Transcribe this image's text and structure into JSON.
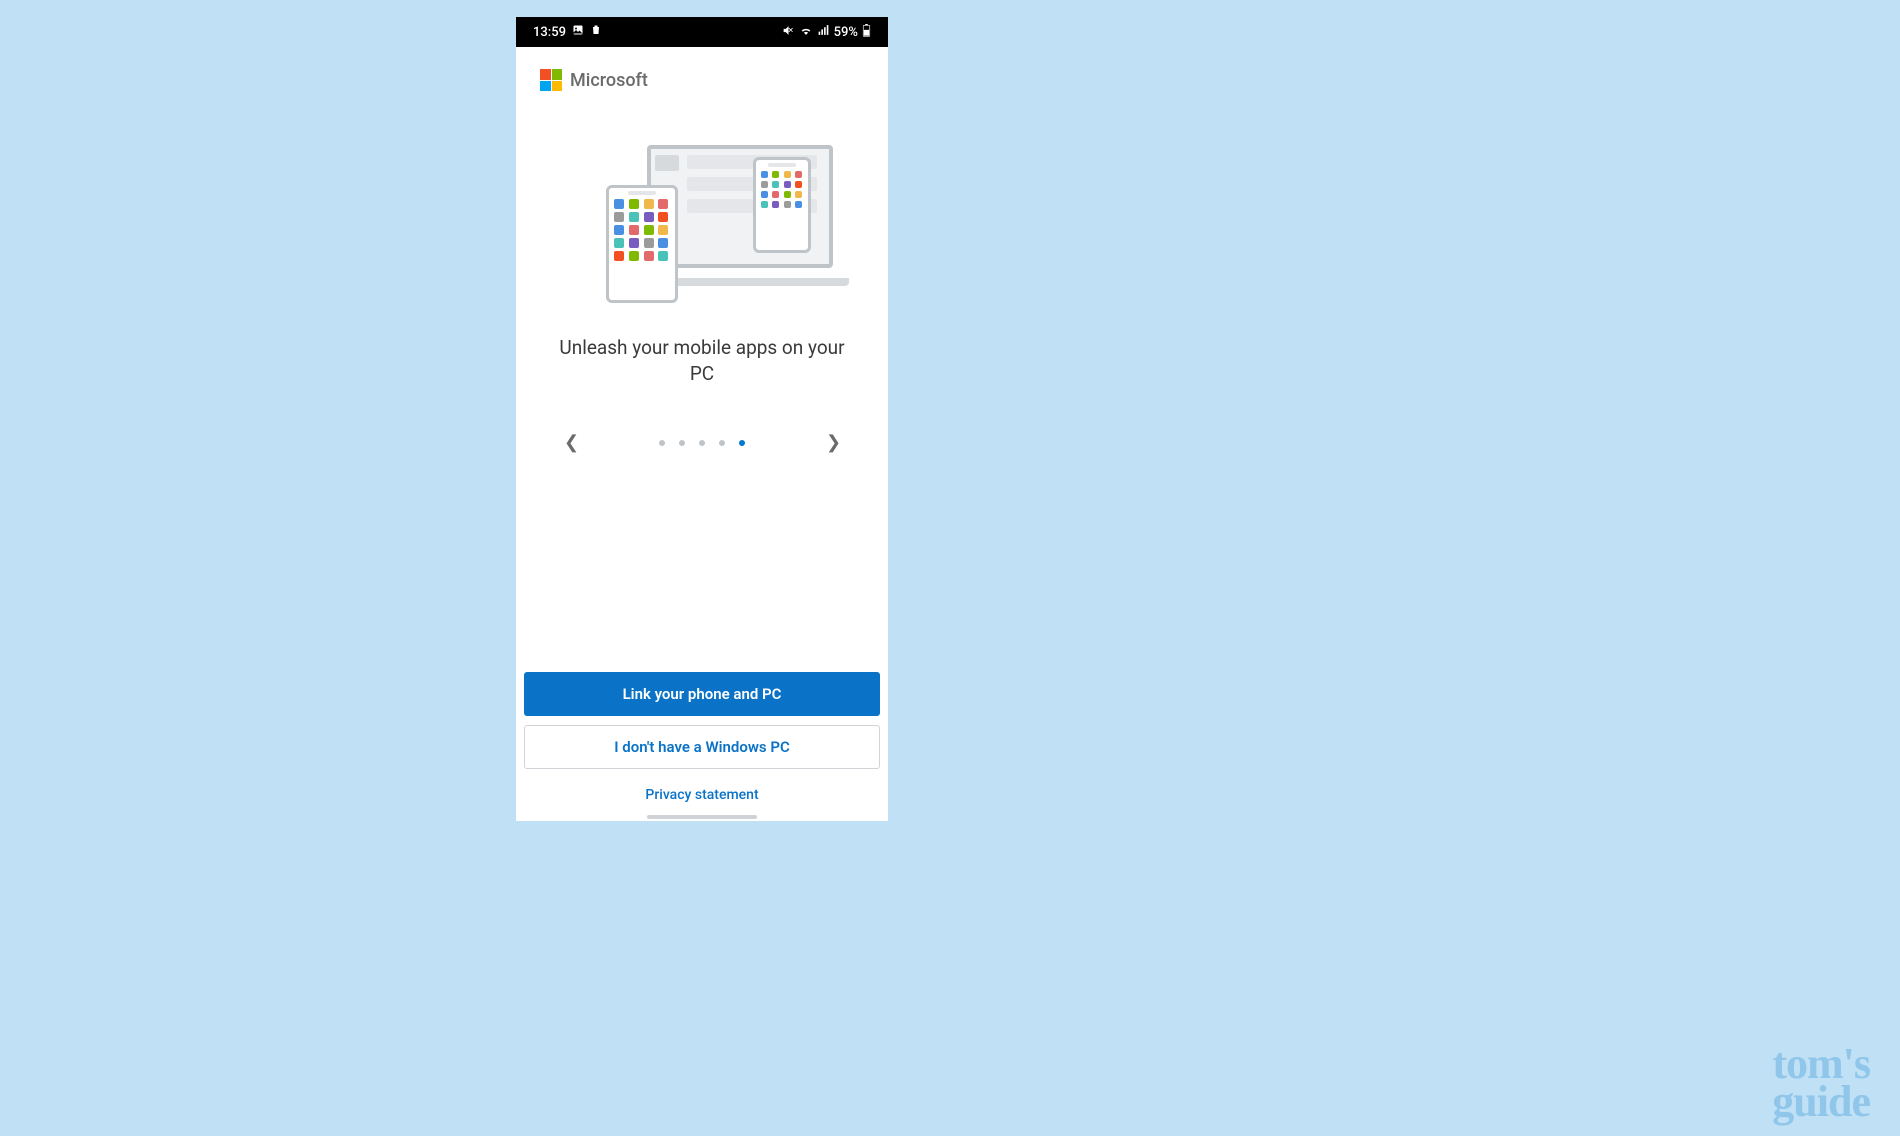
{
  "status_bar": {
    "time": "13:59",
    "battery_text": "59%"
  },
  "brand": {
    "name": "Microsoft"
  },
  "heading": "Unleash your mobile apps on your PC",
  "carousel": {
    "total_dots": 5,
    "active_index": 4
  },
  "buttons": {
    "primary": "Link your phone and PC",
    "secondary": "I don't have a Windows PC"
  },
  "link": "Privacy statement",
  "watermark": {
    "line1": "tom's",
    "line2": "guide"
  },
  "app_colors": [
    "#4a90e2",
    "#7fba00",
    "#f0b84b",
    "#e26a6a",
    "#9b9b9b",
    "#4ac2b8",
    "#7a5cc0",
    "#f25022",
    "#4a90e2",
    "#e26a6a",
    "#7fba00",
    "#f0b84b",
    "#4ac2b8",
    "#7a5cc0",
    "#9b9b9b",
    "#4a90e2",
    "#f25022",
    "#7fba00",
    "#e26a6a",
    "#4ac2b8"
  ]
}
